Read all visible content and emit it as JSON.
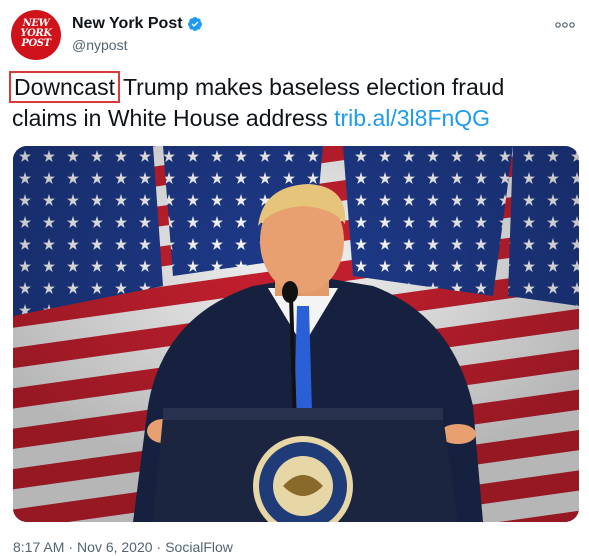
{
  "author": {
    "display_name": "New York Post",
    "handle": "@nypost",
    "avatar_logo_lines": [
      "NEW",
      "YORK",
      "POST"
    ],
    "verified": true,
    "verified_color": "#1d9bf0",
    "avatar_color": "#d0121a"
  },
  "tweet": {
    "highlighted_word": "Downcast",
    "text_rest": " Trump makes baseless election fraud claims in White House address ",
    "link_text": "trib.al/3l8FnQG",
    "link_color": "#1d9bf0",
    "highlight_color": "#d93a3a"
  },
  "media": {
    "description_icon": "photo",
    "seal_text": "PRESIDENT OF THE UNITED STATES"
  },
  "footer": {
    "time": "8:17 AM",
    "separator": "·",
    "date": "Nov 6, 2020",
    "source": "SocialFlow"
  },
  "menu": {
    "icon": "more-horizontal-icon"
  }
}
